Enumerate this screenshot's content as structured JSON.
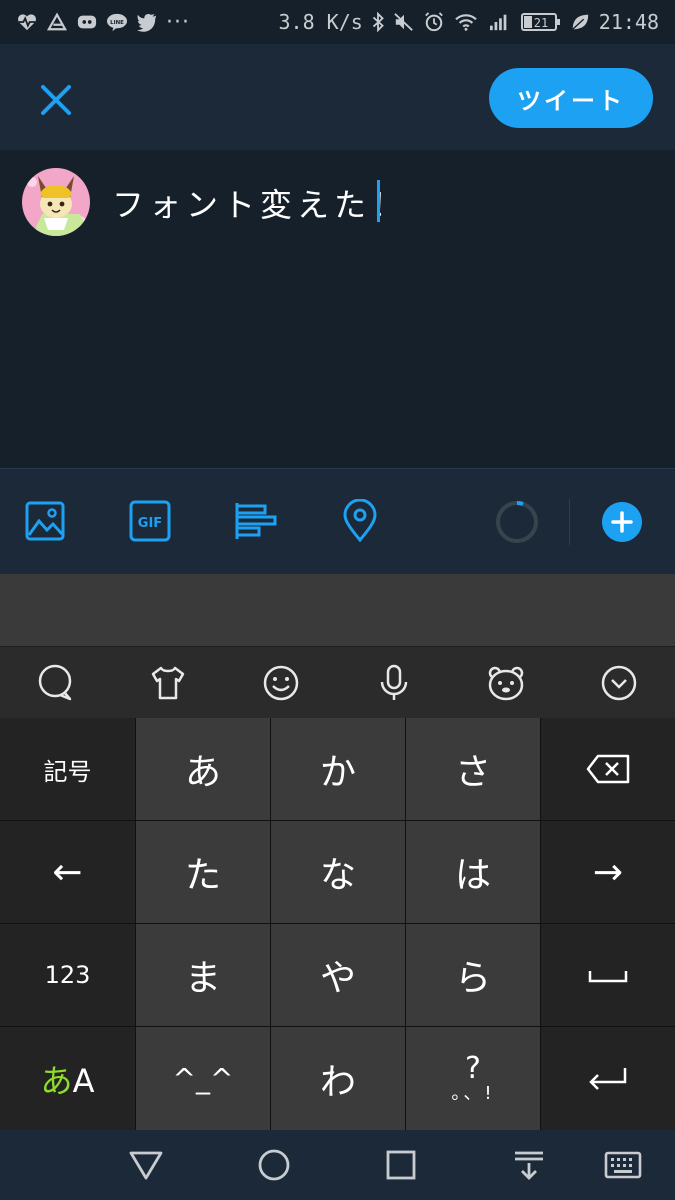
{
  "status_bar": {
    "left_icons": [
      "heart-rate-icon",
      "app-icon",
      "discord-icon",
      "line-icon",
      "twitter-icon"
    ],
    "overflow": "···",
    "net_speed": "3.8 K/s",
    "right_icons": [
      "bluetooth-icon",
      "mute-icon",
      "alarm-icon",
      "wifi-icon",
      "signal-icon"
    ],
    "battery": "21",
    "time": "21:48"
  },
  "header": {
    "tweet_button": "ツイート"
  },
  "compose": {
    "text": "フォント変えた！"
  },
  "toolbar": {
    "gif_label": "GIF"
  },
  "keyboard": {
    "rows": [
      [
        "記号",
        "あ",
        "か",
        "さ",
        "⌫"
      ],
      [
        "←",
        "た",
        "な",
        "は",
        "→"
      ],
      [
        "123",
        "ま",
        "や",
        "ら",
        "␣"
      ],
      [
        "あA",
        "^_^",
        "わ",
        "?。、!",
        "↵"
      ]
    ],
    "symbol_key": "記号",
    "num_key": "123",
    "mode_key_kana": "あ",
    "mode_key_alpha": "A",
    "kana": {
      "a": "あ",
      "ka": "か",
      "sa": "さ",
      "ta": "た",
      "na": "な",
      "ha": "は",
      "ma": "ま",
      "ya": "や",
      "ra": "ら",
      "face": "^_^",
      "wa": "わ"
    },
    "punct_top": "?",
    "punct_bottom": "。、!",
    "left_arrow": "←",
    "right_arrow": "→",
    "accent_green": "#8fdc2c"
  },
  "colors": {
    "accent": "#1da1f2",
    "background": "#15202b",
    "panel": "#1c2938"
  }
}
